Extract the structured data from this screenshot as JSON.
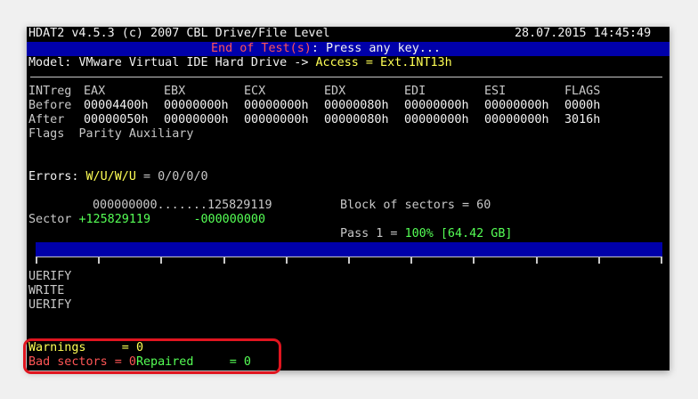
{
  "header": {
    "left": "HDAT2 v4.5.3 (c) 2007 CBL Drive/File Level",
    "datetime": "28.07.2015 14:45:49"
  },
  "status": {
    "label": "End of Test(s)",
    "message": ": Press any key..."
  },
  "model": {
    "label": "Model:",
    "value": "VMware Virtual IDE Hard Drive ->",
    "access": "Access = Ext.INT13h"
  },
  "registers": {
    "headers": [
      "INTreg",
      "EAX",
      "EBX",
      "ECX",
      "EDX",
      "EDI",
      "ESI",
      "FLAGS"
    ],
    "before": [
      "Before",
      "00004400h",
      "00000000h",
      "00000000h",
      "00000080h",
      "00000000h",
      "00000000h",
      "0000h"
    ],
    "after": [
      "After",
      "00000050h",
      "00000000h",
      "00000000h",
      "00000080h",
      "00000000h",
      "00000000h",
      "3016h"
    ],
    "flags_label": "Flags",
    "flags_value": "Parity Auxiliary"
  },
  "errors": {
    "label": "Errors:",
    "codes": "W/U/W/U",
    "values": "= 0/0/0/0"
  },
  "sectors": {
    "range": "000000000.......125829119",
    "label": "Sector",
    "plus": "+125829119",
    "minus": "-000000000",
    "block": "Block of sectors = 60",
    "pass_label": "Pass 1 =",
    "pass_value": "100% [64.42 GB]"
  },
  "progress": {
    "percent": 100
  },
  "log": [
    "UERIFY",
    "WRITE",
    "UERIFY"
  ],
  "summary": {
    "warnings_label": "Warnings     =",
    "warnings_value": "0",
    "bad_label": "Bad sectors =",
    "bad_value": "0",
    "repaired_label": "Repaired     =",
    "repaired_value": "0"
  },
  "colors": {
    "screen": "#000000",
    "blue_bar": "#0000aa",
    "yellow": "#ffff55",
    "red": "#ff5555",
    "green": "#55ff55",
    "highlight": "#e0151f"
  }
}
